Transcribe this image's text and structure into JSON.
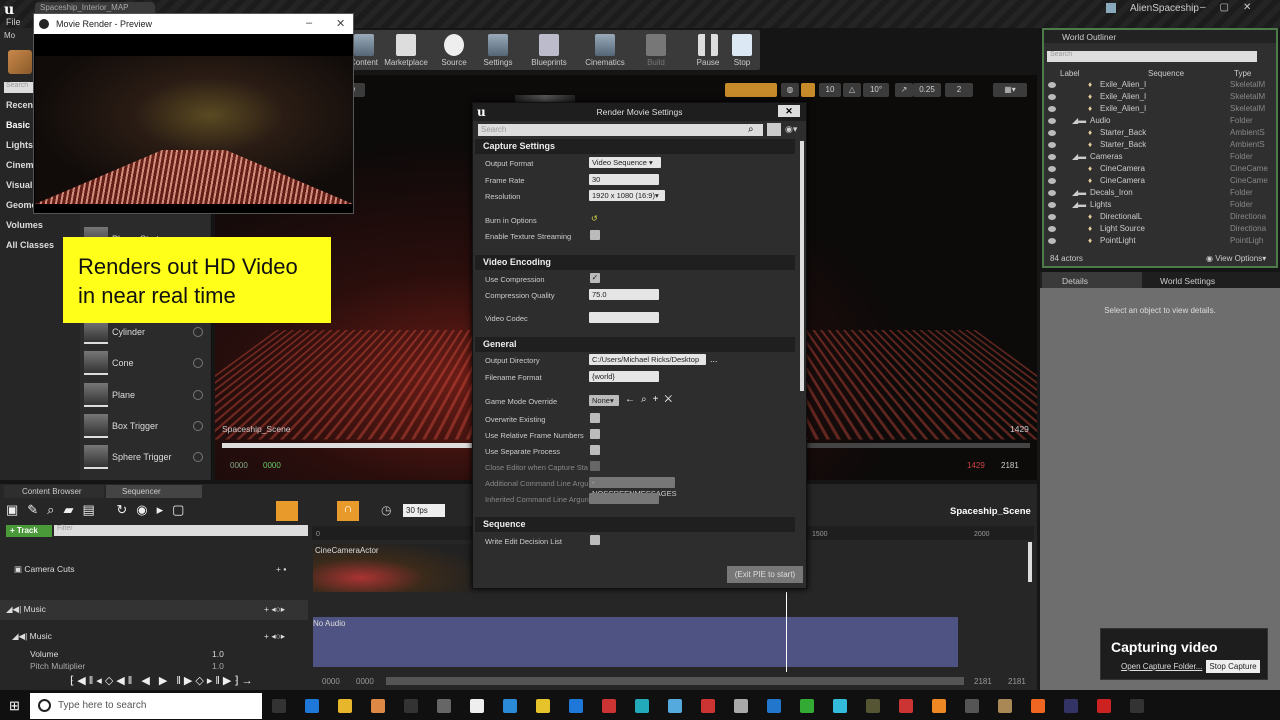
{
  "window": {
    "map_tab": "Spaceship_Interior_MAP",
    "project": "AlienSpaceship",
    "menu_file": "File",
    "modes_tab": "Mo"
  },
  "modes": {
    "search_placeholder": "Search",
    "categories": [
      "Recent",
      "Basic",
      "Lights",
      "Cinema",
      "Visual",
      "Geome",
      "Volumes",
      "All Classes"
    ],
    "items": [
      "Player Start",
      "Cylinder",
      "Cone",
      "Plane",
      "Box Trigger",
      "Sphere Trigger"
    ]
  },
  "toolbar": {
    "buttons": [
      "Content",
      "Marketplace",
      "Source",
      "Settings",
      "Blueprints",
      "Cinematics",
      "Build",
      "Pause",
      "Stop"
    ]
  },
  "viewport": {
    "show_label": "ow",
    "snap_grid": "10",
    "snap_rot": "10°",
    "snap_scale": "0.25",
    "cam_speed": "2",
    "scene_name": "Spaceship_Scene",
    "frame_current": "1429",
    "start_a": "0000",
    "start_b": "0000",
    "end_a": "1429",
    "end_b": "2181"
  },
  "preview": {
    "title": "Movie Render - Preview"
  },
  "overlay": {
    "line1": "Renders out HD Video",
    "line2": "in near real time"
  },
  "dialog": {
    "title": "Render Movie Settings",
    "search_placeholder": "Search",
    "capture": {
      "header": "Capture Settings",
      "output_format_label": "Output Format",
      "output_format": "Video Sequence",
      "frame_rate_label": "Frame Rate",
      "frame_rate": "30",
      "resolution_label": "Resolution",
      "resolution": "1920 x 1080 (16:9)",
      "burn_in_label": "Burn in Options",
      "texture_streaming_label": "Enable Texture Streaming",
      "texture_streaming": false
    },
    "encoding": {
      "header": "Video Encoding",
      "use_compression_label": "Use Compression",
      "use_compression": true,
      "quality_label": "Compression Quality",
      "quality": "75.0",
      "codec_label": "Video Codec",
      "codec": ""
    },
    "general": {
      "header": "General",
      "output_dir_label": "Output Directory",
      "output_dir": "C:/Users/Michael Ricks/Desktop",
      "filename_label": "Filename Format",
      "filename": "{world}",
      "game_mode_label": "Game Mode Override",
      "game_mode": "None",
      "overwrite_label": "Overwrite Existing",
      "relative_label": "Use Relative Frame Numbers",
      "separate_label": "Use Separate Process",
      "close_editor_label": "Close Editor when Capture Sta",
      "additional_label": "Additional Command Line Argu",
      "additional": "-NOSCREENMESSAGES",
      "inherited_label": "Inherited Command Line Argun"
    },
    "sequence": {
      "header": "Sequence",
      "edl_label": "Write Edit Decision List"
    },
    "start_button": "(Exit PIE to start)"
  },
  "outliner": {
    "title": "World Outliner",
    "search_placeholder": "Search",
    "col_label": "Label",
    "col_sequence": "Sequence",
    "col_type": "Type",
    "rows": [
      {
        "label": "Exile_Alien_I",
        "type": "SkeletalM",
        "indent": 2
      },
      {
        "label": "Exile_Alien_I",
        "type": "SkeletalM",
        "indent": 2
      },
      {
        "label": "Exile_Alien_I",
        "type": "SkeletalM",
        "indent": 2
      },
      {
        "label": "Audio",
        "type": "Folder",
        "indent": 1
      },
      {
        "label": "Starter_Back",
        "type": "AmbientS",
        "indent": 2
      },
      {
        "label": "Starter_Back",
        "type": "AmbientS",
        "indent": 2
      },
      {
        "label": "Cameras",
        "type": "Folder",
        "indent": 1
      },
      {
        "label": "CineCamera",
        "type": "CineCame",
        "indent": 2
      },
      {
        "label": "CineCamera",
        "type": "CineCame",
        "indent": 2
      },
      {
        "label": "Decals_Iron",
        "type": "Folder",
        "indent": 1
      },
      {
        "label": "Lights",
        "type": "Folder",
        "indent": 1
      },
      {
        "label": "DirectionalL",
        "type": "Directiona",
        "indent": 2
      },
      {
        "label": "Light Source",
        "type": "Directiona",
        "indent": 2
      },
      {
        "label": "PointLight",
        "type": "PointLigh",
        "indent": 2
      }
    ],
    "actor_count": "84 actors",
    "view_options": "View Options"
  },
  "details": {
    "tab": "Details",
    "world_settings_tab": "World Settings",
    "empty": "Select an object to view details."
  },
  "sequencer": {
    "tab_content": "Content Browser",
    "tab_sequencer": "Sequencer",
    "fps": "30 fps",
    "add_track": "+ Track",
    "filter_placeholder": "Filter",
    "sequence_name": "Spaceship_Scene",
    "ruler": [
      "0",
      "1500",
      "2000"
    ],
    "tracks": [
      {
        "name": "Camera Cuts"
      },
      {
        "name": "Music"
      },
      {
        "name": "Music"
      },
      {
        "name": "Volume",
        "value": "1.0"
      },
      {
        "name": "Pitch Multiplier",
        "value": "1.0"
      }
    ],
    "camera_section": "CineCameraActor",
    "audio_section": "No Audio",
    "range_start_a": "0000",
    "range_start_b": "0000",
    "range_end_a": "2181",
    "range_end_b": "2181"
  },
  "notification": {
    "title": "Capturing video",
    "link": "Open Capture Folder...",
    "button": "Stop Capture"
  },
  "taskbar": {
    "search_placeholder": "Type here to search"
  }
}
